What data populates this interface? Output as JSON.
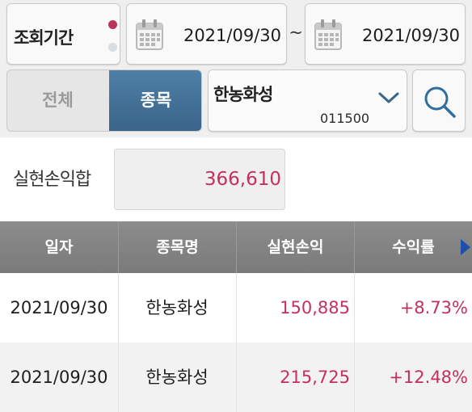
{
  "filter": {
    "period_label": "조회기간",
    "date_from": "2021/09/30",
    "date_separator": "~",
    "date_to": "2021/09/30"
  },
  "segment": {
    "all_label": "전체",
    "stock_label": "종목",
    "selected": "종목"
  },
  "stock_select": {
    "name": "한농화성",
    "code": "011500"
  },
  "summary": {
    "label": "실현손익합",
    "value": "366,610"
  },
  "table": {
    "columns": [
      "일자",
      "종목명",
      "실현손익",
      "수익률"
    ],
    "rows": [
      {
        "date": "2021/09/30",
        "name": "한농화성",
        "pl": "150,885",
        "rate": "+8.73%"
      },
      {
        "date": "2021/09/30",
        "name": "한농화성",
        "pl": "215,725",
        "rate": "+12.48%"
      }
    ]
  },
  "colors": {
    "accent_blue": "#3a6489",
    "profit_red": "#c4305b",
    "header_gray": "#808080"
  },
  "icons": {
    "calendar": "calendar-icon",
    "search": "search-icon",
    "dropdown": "chevron-down-icon",
    "scroll": "arrow-right-icon"
  }
}
